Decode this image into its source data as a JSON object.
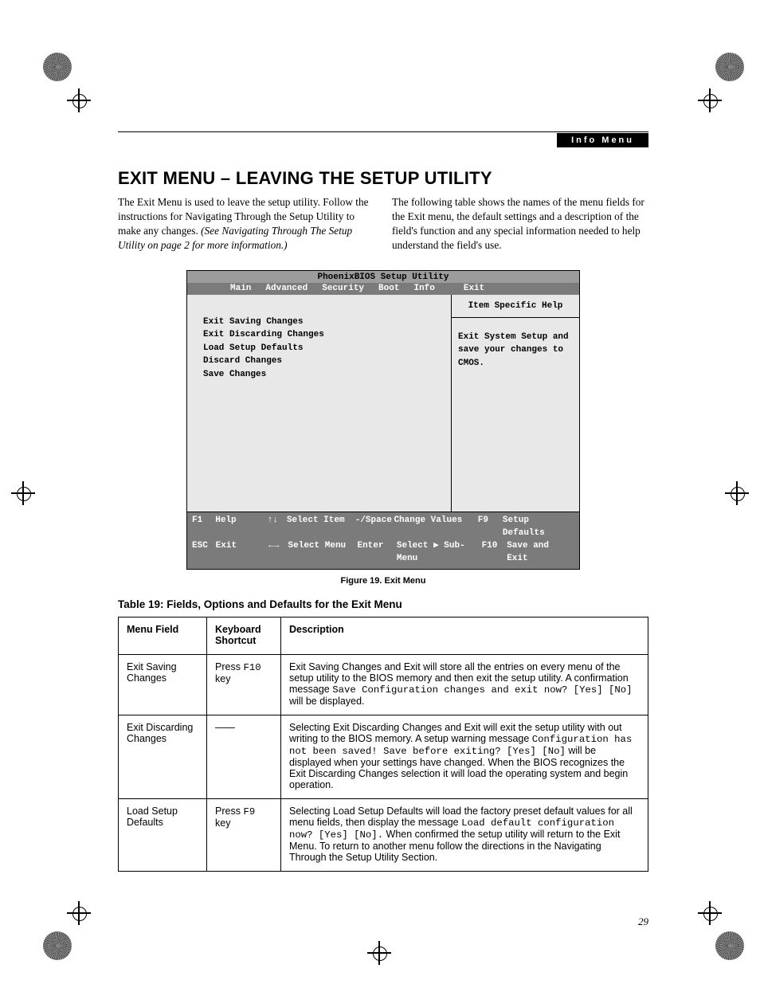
{
  "header": {
    "section_label": "Info Menu"
  },
  "title": "EXIT MENU – LEAVING THE SETUP UTILITY",
  "intro": {
    "left_1": "The Exit Menu is used to leave the setup utility. Follow the instructions for Navigating Through the Setup Utility to make any changes. ",
    "left_italic": "(See Navigating Through The Setup Utility on page 2 for more information.)",
    "right": "The following table shows the names of the menu fields for the Exit menu, the default settings and a description of the field's function and any special information needed to help understand the field's use."
  },
  "bios": {
    "title": "PhoenixBIOS Setup Utility",
    "tabs": [
      "Main",
      "Advanced",
      "Security",
      "Boot",
      "Info",
      "Exit"
    ],
    "left_items": [
      "Exit Saving Changes",
      "Exit Discarding Changes",
      "Load Setup Defaults",
      "Discard Changes",
      "Save Changes"
    ],
    "help_title": "Item Specific Help",
    "help_body": "Exit System Setup and save your changes to CMOS.",
    "footer": {
      "r1": {
        "k1": "F1",
        "l1": "Help",
        "arr1": "↑↓",
        "l2": "Select Item",
        "k2": "-/Space",
        "l3": "Change Values",
        "k3": "F9",
        "l4": "Setup Defaults"
      },
      "r2": {
        "k1": "ESC",
        "l1": "Exit",
        "arr1": "←→",
        "l2": "Select Menu",
        "k2": "Enter",
        "l3": "Select ▶ Sub-Menu",
        "k3": "F10",
        "l4": "Save and Exit"
      }
    }
  },
  "figure_caption": "Figure 19.  Exit Menu",
  "table_caption": "Table 19: Fields, Options and Defaults for the Exit Menu",
  "table": {
    "headers": [
      "Menu Field",
      "Keyboard Shortcut",
      "Description"
    ],
    "rows": [
      {
        "field": "Exit Saving Changes",
        "shortcut_prefix": "Press ",
        "shortcut_key": "F10",
        "shortcut_suffix": " key",
        "desc_a": "Exit Saving Changes and Exit will store all the entries on every menu of the setup utility to the BIOS memory and then exit the setup utility. A confirmation message ",
        "desc_code": "Save Configuration changes and exit now? [Yes] [No]",
        "desc_b": " will be displayed."
      },
      {
        "field": "Exit Discarding Changes",
        "shortcut_plain": "——",
        "desc_a": "Selecting Exit Discarding Changes and Exit will exit the setup utility with out writing to the BIOS memory. A setup warning message ",
        "desc_code": "Configuration has not been saved! Save before exiting? [Yes] [No]",
        "desc_b": " will be displayed when your settings have changed. When the BIOS recognizes the Exit Discarding Changes selection it will load the operating system and begin operation."
      },
      {
        "field": "Load Setup Defaults",
        "shortcut_prefix": "Press ",
        "shortcut_key": "F9",
        "shortcut_suffix": " key",
        "desc_a": "Selecting Load Setup Defaults will load the factory preset default values for all menu fields, then display the message ",
        "desc_code": "Load default configuration now? [Yes] [No].",
        "desc_b": "  When confirmed the setup utility will return to the Exit Menu. To return to another menu follow the directions in the Navigating Through the Setup Utility Section."
      }
    ]
  },
  "page_number": "29"
}
